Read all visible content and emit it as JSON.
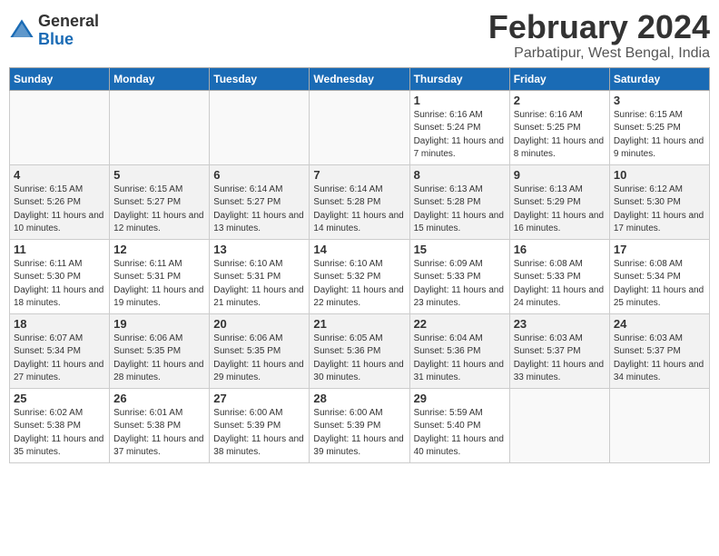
{
  "logo": {
    "general": "General",
    "blue": "Blue"
  },
  "title": "February 2024",
  "location": "Parbatipur, West Bengal, India",
  "days_of_week": [
    "Sunday",
    "Monday",
    "Tuesday",
    "Wednesday",
    "Thursday",
    "Friday",
    "Saturday"
  ],
  "weeks": [
    [
      {
        "day": "",
        "sunrise": "",
        "sunset": "",
        "daylight": ""
      },
      {
        "day": "",
        "sunrise": "",
        "sunset": "",
        "daylight": ""
      },
      {
        "day": "",
        "sunrise": "",
        "sunset": "",
        "daylight": ""
      },
      {
        "day": "",
        "sunrise": "",
        "sunset": "",
        "daylight": ""
      },
      {
        "day": "1",
        "sunrise": "6:16 AM",
        "sunset": "5:24 PM",
        "daylight": "11 hours and 7 minutes."
      },
      {
        "day": "2",
        "sunrise": "6:16 AM",
        "sunset": "5:25 PM",
        "daylight": "11 hours and 8 minutes."
      },
      {
        "day": "3",
        "sunrise": "6:15 AM",
        "sunset": "5:25 PM",
        "daylight": "11 hours and 9 minutes."
      }
    ],
    [
      {
        "day": "4",
        "sunrise": "6:15 AM",
        "sunset": "5:26 PM",
        "daylight": "11 hours and 10 minutes."
      },
      {
        "day": "5",
        "sunrise": "6:15 AM",
        "sunset": "5:27 PM",
        "daylight": "11 hours and 12 minutes."
      },
      {
        "day": "6",
        "sunrise": "6:14 AM",
        "sunset": "5:27 PM",
        "daylight": "11 hours and 13 minutes."
      },
      {
        "day": "7",
        "sunrise": "6:14 AM",
        "sunset": "5:28 PM",
        "daylight": "11 hours and 14 minutes."
      },
      {
        "day": "8",
        "sunrise": "6:13 AM",
        "sunset": "5:28 PM",
        "daylight": "11 hours and 15 minutes."
      },
      {
        "day": "9",
        "sunrise": "6:13 AM",
        "sunset": "5:29 PM",
        "daylight": "11 hours and 16 minutes."
      },
      {
        "day": "10",
        "sunrise": "6:12 AM",
        "sunset": "5:30 PM",
        "daylight": "11 hours and 17 minutes."
      }
    ],
    [
      {
        "day": "11",
        "sunrise": "6:11 AM",
        "sunset": "5:30 PM",
        "daylight": "11 hours and 18 minutes."
      },
      {
        "day": "12",
        "sunrise": "6:11 AM",
        "sunset": "5:31 PM",
        "daylight": "11 hours and 19 minutes."
      },
      {
        "day": "13",
        "sunrise": "6:10 AM",
        "sunset": "5:31 PM",
        "daylight": "11 hours and 21 minutes."
      },
      {
        "day": "14",
        "sunrise": "6:10 AM",
        "sunset": "5:32 PM",
        "daylight": "11 hours and 22 minutes."
      },
      {
        "day": "15",
        "sunrise": "6:09 AM",
        "sunset": "5:33 PM",
        "daylight": "11 hours and 23 minutes."
      },
      {
        "day": "16",
        "sunrise": "6:08 AM",
        "sunset": "5:33 PM",
        "daylight": "11 hours and 24 minutes."
      },
      {
        "day": "17",
        "sunrise": "6:08 AM",
        "sunset": "5:34 PM",
        "daylight": "11 hours and 25 minutes."
      }
    ],
    [
      {
        "day": "18",
        "sunrise": "6:07 AM",
        "sunset": "5:34 PM",
        "daylight": "11 hours and 27 minutes."
      },
      {
        "day": "19",
        "sunrise": "6:06 AM",
        "sunset": "5:35 PM",
        "daylight": "11 hours and 28 minutes."
      },
      {
        "day": "20",
        "sunrise": "6:06 AM",
        "sunset": "5:35 PM",
        "daylight": "11 hours and 29 minutes."
      },
      {
        "day": "21",
        "sunrise": "6:05 AM",
        "sunset": "5:36 PM",
        "daylight": "11 hours and 30 minutes."
      },
      {
        "day": "22",
        "sunrise": "6:04 AM",
        "sunset": "5:36 PM",
        "daylight": "11 hours and 31 minutes."
      },
      {
        "day": "23",
        "sunrise": "6:03 AM",
        "sunset": "5:37 PM",
        "daylight": "11 hours and 33 minutes."
      },
      {
        "day": "24",
        "sunrise": "6:03 AM",
        "sunset": "5:37 PM",
        "daylight": "11 hours and 34 minutes."
      }
    ],
    [
      {
        "day": "25",
        "sunrise": "6:02 AM",
        "sunset": "5:38 PM",
        "daylight": "11 hours and 35 minutes."
      },
      {
        "day": "26",
        "sunrise": "6:01 AM",
        "sunset": "5:38 PM",
        "daylight": "11 hours and 37 minutes."
      },
      {
        "day": "27",
        "sunrise": "6:00 AM",
        "sunset": "5:39 PM",
        "daylight": "11 hours and 38 minutes."
      },
      {
        "day": "28",
        "sunrise": "6:00 AM",
        "sunset": "5:39 PM",
        "daylight": "11 hours and 39 minutes."
      },
      {
        "day": "29",
        "sunrise": "5:59 AM",
        "sunset": "5:40 PM",
        "daylight": "11 hours and 40 minutes."
      },
      {
        "day": "",
        "sunrise": "",
        "sunset": "",
        "daylight": ""
      },
      {
        "day": "",
        "sunrise": "",
        "sunset": "",
        "daylight": ""
      }
    ]
  ]
}
